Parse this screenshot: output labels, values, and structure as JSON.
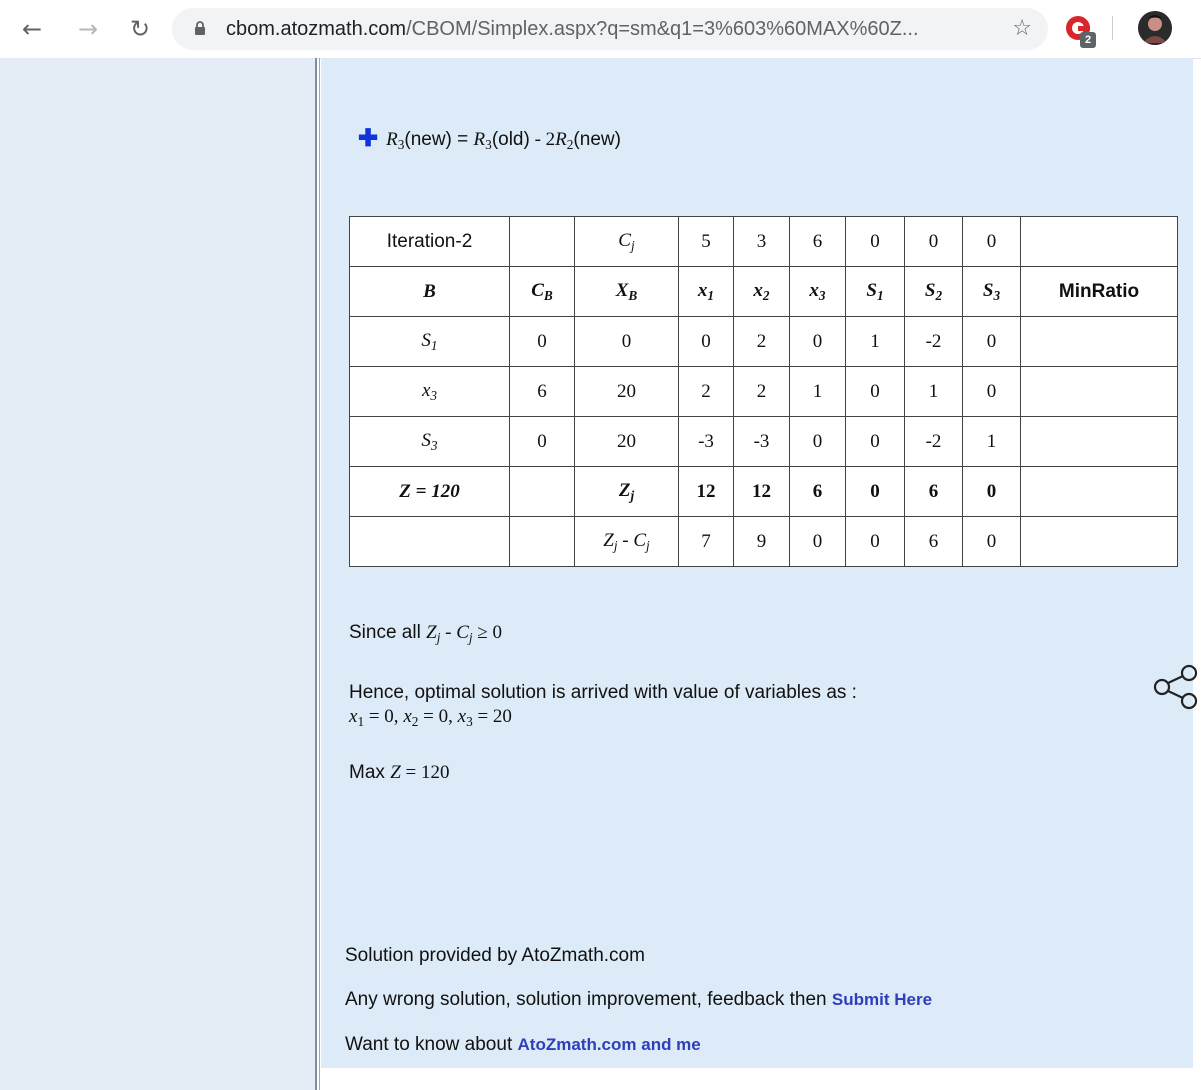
{
  "browser": {
    "url_host": "cbom.atozmath.com",
    "url_path": "/CBOM/Simplex.aspx?q=sm&q1=3%603%60MAX%60Z...",
    "extension_badge": "2"
  },
  "step": {
    "lhs_var": "R",
    "lhs_sub": "3",
    "lhs_tag": "(new)",
    "eq": " = ",
    "rhs_var": "R",
    "rhs_sub": "3",
    "rhs_tag": "(old)",
    "minus": " - 2",
    "r2_var": "R",
    "r2_sub": "2",
    "r2_tag": "(new)"
  },
  "table": {
    "iteration_label": "Iteration-2",
    "cj_label": "C",
    "cj_sub": "j",
    "cj_values": [
      "5",
      "3",
      "6",
      "0",
      "0",
      "0"
    ],
    "header": {
      "b": "B",
      "cb": "C",
      "cb_sub": "B",
      "xb": "X",
      "xb_sub": "B",
      "vars": [
        {
          "name": "x",
          "sub": "1"
        },
        {
          "name": "x",
          "sub": "2"
        },
        {
          "name": "x",
          "sub": "3"
        },
        {
          "name": "S",
          "sub": "1"
        },
        {
          "name": "S",
          "sub": "2"
        },
        {
          "name": "S",
          "sub": "3"
        }
      ],
      "minratio": "MinRatio"
    },
    "rows": [
      {
        "basis": "S",
        "basis_sub": "1",
        "cb": "0",
        "xb": "0",
        "vals": [
          "0",
          "2",
          "0",
          "1",
          "-2",
          "0"
        ]
      },
      {
        "basis": "x",
        "basis_sub": "3",
        "cb": "6",
        "xb": "20",
        "vals": [
          "2",
          "2",
          "1",
          "0",
          "1",
          "0"
        ]
      },
      {
        "basis": "S",
        "basis_sub": "3",
        "cb": "0",
        "xb": "20",
        "vals": [
          "-3",
          "-3",
          "0",
          "0",
          "-2",
          "1"
        ]
      }
    ],
    "z_row": {
      "z_label": "Z = 120",
      "zj_label": "Z",
      "zj_sub": "j",
      "vals": [
        "12",
        "12",
        "6",
        "0",
        "6",
        "0"
      ]
    },
    "diff_row": {
      "label_z": "Z",
      "label_z_sub": "j",
      "label_mid": " - ",
      "label_c": "C",
      "label_c_sub": "j",
      "vals": [
        "7",
        "9",
        "0",
        "0",
        "6",
        "0"
      ]
    }
  },
  "conclusion": {
    "since_prefix": "Since all ",
    "since_z": "Z",
    "since_z_sub": "j",
    "since_mid": " - ",
    "since_c": "C",
    "since_c_sub": "j",
    "since_suffix": " ≥ 0",
    "hence": "Hence, optimal solution is arrived with value of variables as :",
    "solution": [
      {
        "var": "x",
        "sub": "1",
        "val": " = 0, "
      },
      {
        "var": "x",
        "sub": "2",
        "val": " = 0, "
      },
      {
        "var": "x",
        "sub": "3",
        "val": " = 20"
      }
    ],
    "max_prefix": "Max ",
    "max_var": "Z",
    "max_val": " = 120"
  },
  "footer": {
    "provided": "Solution provided by AtoZmath.com",
    "feedback_prefix": "Any wrong solution, solution improvement, feedback then ",
    "feedback_link": "Submit Here",
    "about_prefix": "Want to know about ",
    "about_link": "AtoZmath.com and me"
  },
  "icons": [
    "back-icon",
    "forward-icon",
    "reload-icon",
    "lock-icon",
    "bookmark-star-icon",
    "extension-icon",
    "profile-avatar",
    "share-icon",
    "plus-icon"
  ]
}
